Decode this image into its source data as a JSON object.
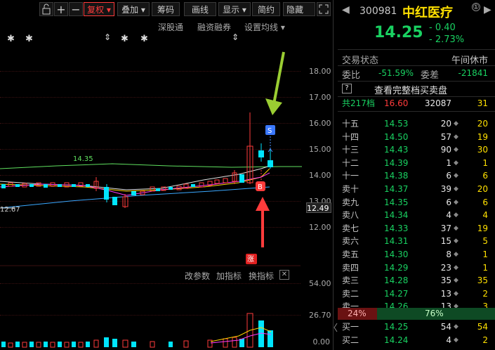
{
  "toolbar": {
    "buttons": [
      "复权",
      "叠加",
      "筹码",
      "画线",
      "显示",
      "简约",
      "隐藏"
    ],
    "sub_links": [
      "深股通",
      "融资融券",
      "设置均线"
    ]
  },
  "chart": {
    "price_axis": [
      "18.00",
      "17.00",
      "16.00",
      "15.00",
      "14.00",
      "13.00",
      "12.00"
    ],
    "current_price_tag": "12.49",
    "high_marker": "14.35",
    "low_marker": "12.67",
    "badge_s": "S",
    "badge_b": "B",
    "badge_zhang": "涨",
    "volume_tools": [
      "改参数",
      "加指标",
      "换指标"
    ],
    "volume_axis": [
      "54.00",
      "26.70",
      "0.00"
    ],
    "colors": {
      "up": "#ff3b3b",
      "down": "#00e5ff",
      "arrow_green": "#9acd32",
      "arrow_red": "#ff3b3b"
    }
  },
  "quote": {
    "code": "300981",
    "name": "中红医疗",
    "price": "14.25",
    "change": "- 0.40",
    "change_pct": "- 2.73%",
    "status_label": "交易状态",
    "status_value": "午间休市",
    "weibi_label": "委比",
    "weibi_value": "-51.59%",
    "weicha_label": "委差",
    "weicha_value": "-21841",
    "full_book_link": "查看完整档买卖盘",
    "total_label": "共217档",
    "total_price": "16.60",
    "total_volume": "32087",
    "total_change": "31",
    "asks": [
      {
        "label": "十五",
        "price": "14.53",
        "volume": "20",
        "change": "20"
      },
      {
        "label": "十四",
        "price": "14.50",
        "volume": "57",
        "change": "19"
      },
      {
        "label": "十三",
        "price": "14.43",
        "volume": "90",
        "change": "30"
      },
      {
        "label": "十二",
        "price": "14.39",
        "volume": "1",
        "change": "1"
      },
      {
        "label": "十一",
        "price": "14.38",
        "volume": "6",
        "change": "6"
      },
      {
        "label": "卖十",
        "price": "14.37",
        "volume": "39",
        "change": "20"
      },
      {
        "label": "卖九",
        "price": "14.35",
        "volume": "6",
        "change": "6"
      },
      {
        "label": "卖八",
        "price": "14.34",
        "volume": "4",
        "change": "4"
      },
      {
        "label": "卖七",
        "price": "14.33",
        "volume": "37",
        "change": "19"
      },
      {
        "label": "卖六",
        "price": "14.31",
        "volume": "15",
        "change": "5"
      },
      {
        "label": "卖五",
        "price": "14.30",
        "volume": "8",
        "change": "1"
      },
      {
        "label": "卖四",
        "price": "14.29",
        "volume": "23",
        "change": "1"
      },
      {
        "label": "卖三",
        "price": "14.28",
        "volume": "35",
        "change": "35"
      },
      {
        "label": "卖二",
        "price": "14.27",
        "volume": "13",
        "change": "2"
      },
      {
        "label": "卖一",
        "price": "14.26",
        "volume": "13",
        "change": "3"
      }
    ],
    "sell_ratio": "24%",
    "buy_ratio": "76%",
    "bids": [
      {
        "label": "买一",
        "price": "14.25",
        "volume": "54",
        "change": "54"
      },
      {
        "label": "买二",
        "price": "14.24",
        "volume": "4",
        "change": "2"
      }
    ]
  }
}
